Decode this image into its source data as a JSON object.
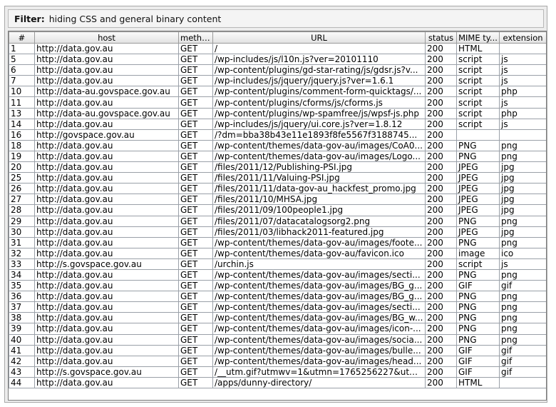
{
  "filter": {
    "label": "Filter:",
    "text": "hiding CSS and general binary content"
  },
  "columns": [
    "#",
    "host",
    "method",
    "URL",
    "status",
    "MIME ty...",
    "extension"
  ],
  "rows": [
    [
      "1",
      "http://data.gov.au",
      "GET",
      "/",
      "200",
      "HTML",
      ""
    ],
    [
      "5",
      "http://data.gov.au",
      "GET",
      "/wp-includes/js/l10n.js?ver=20101110",
      "200",
      "script",
      "js"
    ],
    [
      "6",
      "http://data.gov.au",
      "GET",
      "/wp-content/plugins/gd-star-rating/js/gdsr.js?v...",
      "200",
      "script",
      "js"
    ],
    [
      "7",
      "http://data.gov.au",
      "GET",
      "/wp-includes/js/jquery/jquery.js?ver=1.6.1",
      "200",
      "script",
      "js"
    ],
    [
      "10",
      "http://data-au.govspace.gov.au",
      "GET",
      "/wp-content/plugins/comment-form-quicktags/...",
      "200",
      "script",
      "php"
    ],
    [
      "11",
      "http://data.gov.au",
      "GET",
      "/wp-content/plugins/cforms/js/cforms.js",
      "200",
      "script",
      "js"
    ],
    [
      "13",
      "http://data-au.govspace.gov.au",
      "GET",
      "/wp-content/plugins/wp-spamfree/js/wpsf-js.php",
      "200",
      "script",
      "php"
    ],
    [
      "14",
      "http://data.gov.au",
      "GET",
      "/wp-includes/js/jquery/ui.core.js?ver=1.8.12",
      "200",
      "script",
      "js"
    ],
    [
      "16",
      "http://govspace.gov.au",
      "GET",
      "/?dm=bba38b43e11e1893f8fe5567f3188745...",
      "200",
      "",
      ""
    ],
    [
      "18",
      "http://data.gov.au",
      "GET",
      "/wp-content/themes/data-gov-au/images/CoA0...",
      "200",
      "PNG",
      "png"
    ],
    [
      "19",
      "http://data.gov.au",
      "GET",
      "/wp-content/themes/data-gov-au/images/Logo...",
      "200",
      "PNG",
      "png"
    ],
    [
      "20",
      "http://data.gov.au",
      "GET",
      "/files/2011/12/Publishing-PSI.jpg",
      "200",
      "JPEG",
      "jpg"
    ],
    [
      "25",
      "http://data.gov.au",
      "GET",
      "/files/2011/11/Valuing-PSI.jpg",
      "200",
      "JPEG",
      "jpg"
    ],
    [
      "26",
      "http://data.gov.au",
      "GET",
      "/files/2011/11/data-gov-au_hackfest_promo.jpg",
      "200",
      "JPEG",
      "jpg"
    ],
    [
      "27",
      "http://data.gov.au",
      "GET",
      "/files/2011/10/MHSA.jpg",
      "200",
      "JPEG",
      "jpg"
    ],
    [
      "28",
      "http://data.gov.au",
      "GET",
      "/files/2011/09/100people1.jpg",
      "200",
      "JPEG",
      "jpg"
    ],
    [
      "29",
      "http://data.gov.au",
      "GET",
      "/files/2011/07/datacatalogsorg2.png",
      "200",
      "PNG",
      "png"
    ],
    [
      "30",
      "http://data.gov.au",
      "GET",
      "/files/2011/03/libhack2011-featured.jpg",
      "200",
      "JPEG",
      "jpg"
    ],
    [
      "31",
      "http://data.gov.au",
      "GET",
      "/wp-content/themes/data-gov-au/images/foote...",
      "200",
      "PNG",
      "png"
    ],
    [
      "32",
      "http://data.gov.au",
      "GET",
      "/wp-content/themes/data-gov-au/favicon.ico",
      "200",
      "image",
      "ico"
    ],
    [
      "33",
      "http://s.govspace.gov.au",
      "GET",
      "/urchin.js",
      "200",
      "script",
      "js"
    ],
    [
      "34",
      "http://data.gov.au",
      "GET",
      "/wp-content/themes/data-gov-au/images/secti...",
      "200",
      "PNG",
      "png"
    ],
    [
      "35",
      "http://data.gov.au",
      "GET",
      "/wp-content/themes/data-gov-au/images/BG_g...",
      "200",
      "GIF",
      "gif"
    ],
    [
      "36",
      "http://data.gov.au",
      "GET",
      "/wp-content/themes/data-gov-au/images/BG_g...",
      "200",
      "PNG",
      "png"
    ],
    [
      "37",
      "http://data.gov.au",
      "GET",
      "/wp-content/themes/data-gov-au/images/secti...",
      "200",
      "PNG",
      "png"
    ],
    [
      "38",
      "http://data.gov.au",
      "GET",
      "/wp-content/themes/data-gov-au/images/BG_w...",
      "200",
      "PNG",
      "png"
    ],
    [
      "39",
      "http://data.gov.au",
      "GET",
      "/wp-content/themes/data-gov-au/images/icon-...",
      "200",
      "PNG",
      "png"
    ],
    [
      "40",
      "http://data.gov.au",
      "GET",
      "/wp-content/themes/data-gov-au/images/socia...",
      "200",
      "PNG",
      "png"
    ],
    [
      "41",
      "http://data.gov.au",
      "GET",
      "/wp-content/themes/data-gov-au/images/bulle...",
      "200",
      "GIF",
      "gif"
    ],
    [
      "42",
      "http://data.gov.au",
      "GET",
      "/wp-content/themes/data-gov-au/images/head...",
      "200",
      "GIF",
      "gif"
    ],
    [
      "43",
      "http://s.govspace.gov.au",
      "GET",
      "/__utm.gif?utmwv=1&utmn=1765256227&utm...",
      "200",
      "GIF",
      "gif"
    ],
    [
      "44",
      "http://data.gov.au",
      "GET",
      "/apps/dunny-directory/",
      "200",
      "HTML",
      ""
    ]
  ]
}
